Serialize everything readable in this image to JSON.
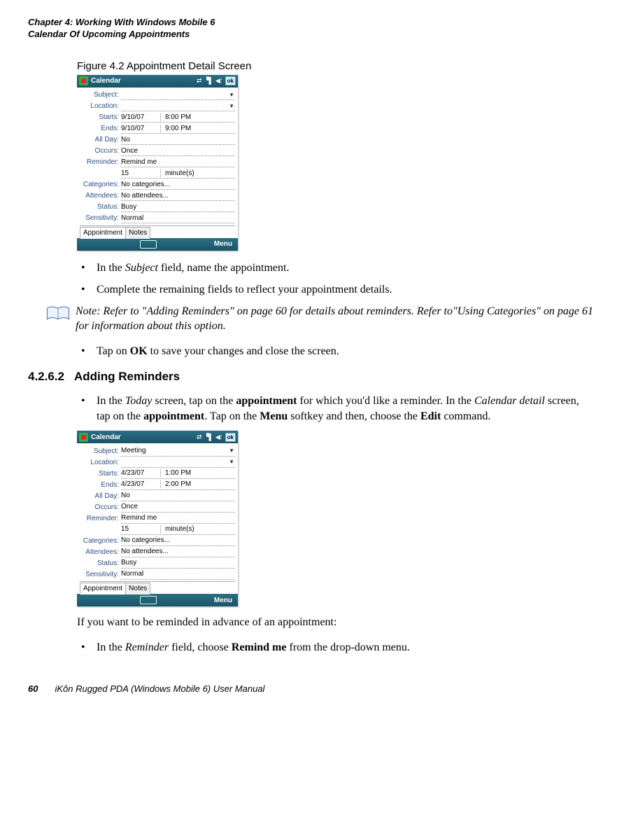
{
  "header": {
    "chapter_line": "Chapter 4:  Working With Windows Mobile 6",
    "section_line": "Calendar Of Upcoming Appointments"
  },
  "figure1": {
    "caption": "Figure 4.2  Appointment Detail Screen",
    "titlebar": "Calendar",
    "ok": "ok",
    "fields": {
      "subject_label": "Subject:",
      "subject_value": "",
      "location_label": "Location:",
      "location_value": "",
      "starts_label": "Starts:",
      "starts_date": "9/10/07",
      "starts_time": "8:00 PM",
      "ends_label": "Ends:",
      "ends_date": "9/10/07",
      "ends_time": "9:00 PM",
      "allday_label": "All Day:",
      "allday_value": "No",
      "occurs_label": "Occurs:",
      "occurs_value": "Once",
      "reminder_label": "Reminder:",
      "reminder_value": "Remind me",
      "reminder_qty": "15",
      "reminder_unit": "minute(s)",
      "categories_label": "Categories:",
      "categories_value": "No categories...",
      "attendees_label": "Attendees:",
      "attendees_value": "No attendees...",
      "status_label": "Status:",
      "status_value": "Busy",
      "sensitivity_label": "Sensitivity:",
      "sensitivity_value": "Normal"
    },
    "tabs": {
      "appointment": "Appointment",
      "notes": "Notes"
    },
    "softkeys": {
      "left": "",
      "right": "Menu"
    }
  },
  "bullets_a": {
    "item1_pre": "In the ",
    "item1_em": "Subject",
    "item1_post": " field, name the appointment.",
    "item2": "Complete the remaining fields to reflect your appointment details."
  },
  "note": {
    "lead": "Note: ",
    "text_a": "Refer to \"Adding Reminders\" on page 60 for details about reminders. Refer to",
    "text_b": "\"Using Categories\" on page 61 for information about this option."
  },
  "bullets_b": {
    "item1_pre": "Tap on ",
    "item1_bold": "OK",
    "item1_post": " to save your changes and close the screen."
  },
  "heading": {
    "number": "4.2.6.2",
    "title": "Adding Reminders"
  },
  "bullets_c": {
    "item1_a": "In the ",
    "item1_em1": "Today",
    "item1_b": " screen, tap on the ",
    "item1_bold1": "appointment",
    "item1_c": " for which you'd like a reminder. In the ",
    "item1_em2": "Calendar detail",
    "item1_d": " screen, tap on the ",
    "item1_bold2": "appointment",
    "item1_e": ". Tap on the ",
    "item1_bold3": "Menu",
    "item1_f": " softkey and then, choose the ",
    "item1_bold4": "Edit",
    "item1_g": " command."
  },
  "figure2": {
    "titlebar": "Calendar",
    "ok": "ok",
    "fields": {
      "subject_label": "Subject:",
      "subject_value": "Meeting",
      "location_label": "Location:",
      "location_value": "",
      "starts_label": "Starts:",
      "starts_date": "4/23/07",
      "starts_time": "1:00 PM",
      "ends_label": "Ends:",
      "ends_date": "4/23/07",
      "ends_time": "2:00 PM",
      "allday_label": "All Day:",
      "allday_value": "No",
      "occurs_label": "Occurs:",
      "occurs_value": "Once",
      "reminder_label": "Reminder:",
      "reminder_value": "Remind me",
      "reminder_qty": "15",
      "reminder_unit": "minute(s)",
      "categories_label": "Categories:",
      "categories_value": "No categories...",
      "attendees_label": "Attendees:",
      "attendees_value": "No attendees...",
      "status_label": "Status:",
      "status_value": "Busy",
      "sensitivity_label": "Sensitivity:",
      "sensitivity_value": "Normal"
    },
    "tabs": {
      "appointment": "Appointment",
      "notes": "Notes"
    },
    "softkeys": {
      "left": "",
      "right": "Menu"
    }
  },
  "para_after": "If you want to be reminded in advance of an appointment:",
  "bullets_d": {
    "item1_a": "In the ",
    "item1_em": "Reminder",
    "item1_b": " field, choose ",
    "item1_bold": "Remind me",
    "item1_c": " from the drop-down menu."
  },
  "footer": {
    "pagenum": "60",
    "manual": "iKôn Rugged PDA (Windows Mobile 6) User Manual"
  }
}
